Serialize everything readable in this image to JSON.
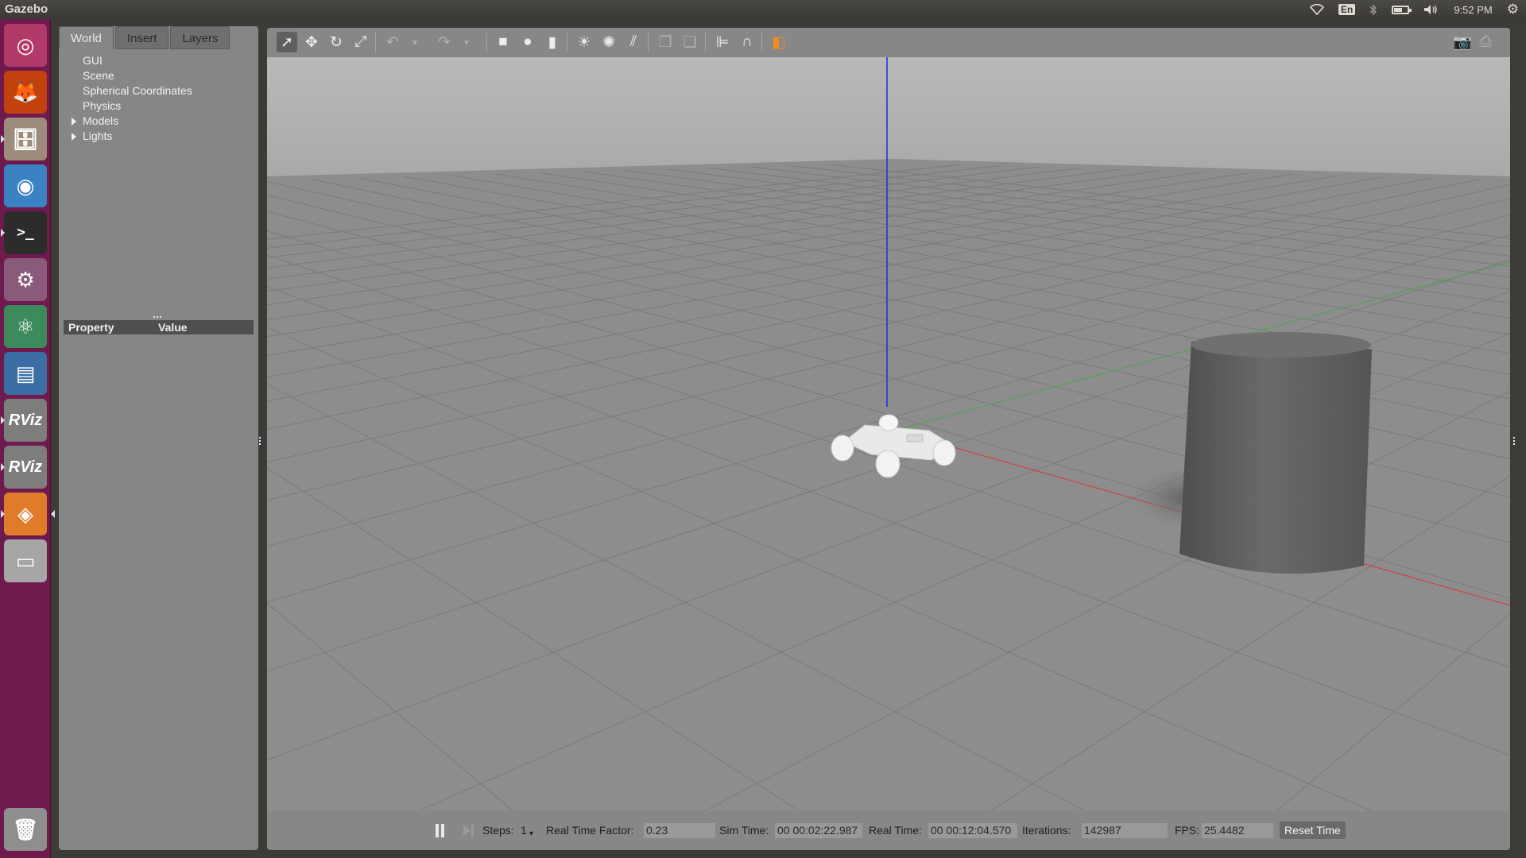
{
  "top_panel": {
    "app_title": "Gazebo",
    "keyboard_layout": "En",
    "clock": "9:52 PM"
  },
  "launcher": {
    "items": [
      {
        "name": "ubuntu-dash",
        "glyph": "◎",
        "bg": "#b23a68"
      },
      {
        "name": "firefox",
        "glyph": "🦊",
        "bg": "#c2410c"
      },
      {
        "name": "files",
        "glyph": "🗄",
        "bg": "#9d8b7b"
      },
      {
        "name": "chrome",
        "glyph": "◉",
        "bg": "#3b82c4"
      },
      {
        "name": "terminal",
        "glyph": ">_",
        "bg": "#2c2c2c"
      },
      {
        "name": "system-settings",
        "glyph": "⚙",
        "bg": "#8a5a7a"
      },
      {
        "name": "atom",
        "glyph": "⚛",
        "bg": "#3d8a5c"
      },
      {
        "name": "writer",
        "glyph": "▤",
        "bg": "#3a6ea5"
      },
      {
        "name": "rviz-1",
        "glyph": "RViz",
        "bg": "#7d7d7d"
      },
      {
        "name": "rviz-2",
        "glyph": "RViz",
        "bg": "#7d7d7d"
      },
      {
        "name": "gazebo",
        "glyph": "◈",
        "bg": "#e07b2a"
      },
      {
        "name": "drive",
        "glyph": "▭",
        "bg": "#a6a6a6"
      },
      {
        "name": "trash",
        "glyph": "🗑",
        "bg": "#8e8e8e"
      }
    ]
  },
  "left_panel": {
    "tabs": [
      {
        "label": "World",
        "active": true
      },
      {
        "label": "Insert",
        "active": false
      },
      {
        "label": "Layers",
        "active": false
      }
    ],
    "tree": [
      {
        "label": "GUI",
        "expandable": false
      },
      {
        "label": "Scene",
        "expandable": false
      },
      {
        "label": "Spherical Coordinates",
        "expandable": false
      },
      {
        "label": "Physics",
        "expandable": false
      },
      {
        "label": "Models",
        "expandable": true
      },
      {
        "label": "Lights",
        "expandable": true
      }
    ],
    "property_header": {
      "property": "Property",
      "value": "Value"
    }
  },
  "toolbar": {
    "tools": [
      {
        "name": "select-mode-icon",
        "glyph": "➚",
        "active": true
      },
      {
        "name": "translate-mode-icon",
        "glyph": "✥"
      },
      {
        "name": "rotate-mode-icon",
        "glyph": "↻"
      },
      {
        "name": "scale-mode-icon",
        "glyph": "⤢"
      },
      {
        "name": "undo-icon",
        "glyph": "↶",
        "dim": true
      },
      {
        "name": "undo-dropdown-icon",
        "glyph": "▾",
        "dim": true
      },
      {
        "name": "redo-icon",
        "glyph": "↷",
        "dim": true
      },
      {
        "name": "redo-dropdown-icon",
        "glyph": "▾",
        "dim": true
      },
      {
        "name": "box-shape-icon",
        "glyph": "■"
      },
      {
        "name": "sphere-shape-icon",
        "glyph": "●"
      },
      {
        "name": "cylinder-shape-icon",
        "glyph": "▮"
      },
      {
        "name": "point-light-icon",
        "glyph": "☀"
      },
      {
        "name": "spot-light-icon",
        "glyph": "✺"
      },
      {
        "name": "directional-light-icon",
        "glyph": "⫽"
      },
      {
        "name": "copy-icon",
        "glyph": "❐",
        "dim": true
      },
      {
        "name": "paste-icon",
        "glyph": "❏",
        "dim": true
      },
      {
        "name": "align-icon",
        "glyph": "⊫"
      },
      {
        "name": "snap-icon",
        "glyph": "∩"
      },
      {
        "name": "view-angle-icon",
        "glyph": "◧"
      },
      {
        "name": "screenshot-icon",
        "glyph": "📷",
        "dim": true
      },
      {
        "name": "log-icon",
        "glyph": "⎙",
        "dim": true
      }
    ]
  },
  "status_bar": {
    "steps_label": "Steps:",
    "steps_value": "1",
    "rtf_label": "Real Time Factor:",
    "rtf_value": "0.23",
    "sim_time_label": "Sim Time:",
    "sim_time_value": "00 00:02:22.987",
    "real_time_label": "Real Time:",
    "real_time_value": "00 00:12:04.570",
    "iterations_label": "Iterations:",
    "iterations_value": "142987",
    "fps_label": "FPS:",
    "fps_value": "25.4482",
    "reset_label": "Reset Time"
  },
  "scene_colors": {
    "sky": "#b5b5b5",
    "ground": "#8d8d8d",
    "grid": "#7a7a7a",
    "z_axis": "#2233dd",
    "x_axis": "#c44a4a",
    "y_axis": "#58a058"
  }
}
